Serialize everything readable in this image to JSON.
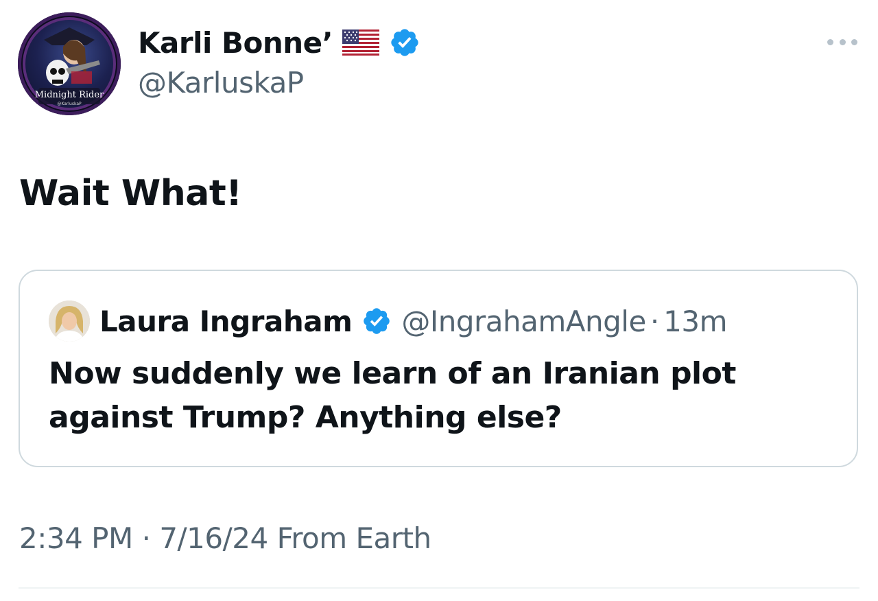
{
  "tweet": {
    "author": {
      "display_name": "Karli Bonne’",
      "handle": "@KarluskaP",
      "avatar_text": "Midnight Rider",
      "avatar_subtext": "@KarluskaP",
      "flag_icon": "us-flag-icon",
      "verified_icon": "verified-badge-icon"
    },
    "more_icon": "more-options-icon",
    "text": "Wait What!",
    "quoted": {
      "display_name": "Laura Ingraham",
      "handle": "@IngrahamAngle",
      "separator": "·",
      "time": "13m",
      "text": "Now suddenly we learn of an Iranian plot against Trump? Anything else?"
    },
    "meta": {
      "time": "2:34 PM",
      "separator": "·",
      "date": "7/16/24",
      "location": "From Earth"
    }
  },
  "colors": {
    "text_primary": "#0f1419",
    "text_secondary": "#536471",
    "verified_blue": "#1d9bf0",
    "border": "#cfd9de"
  }
}
